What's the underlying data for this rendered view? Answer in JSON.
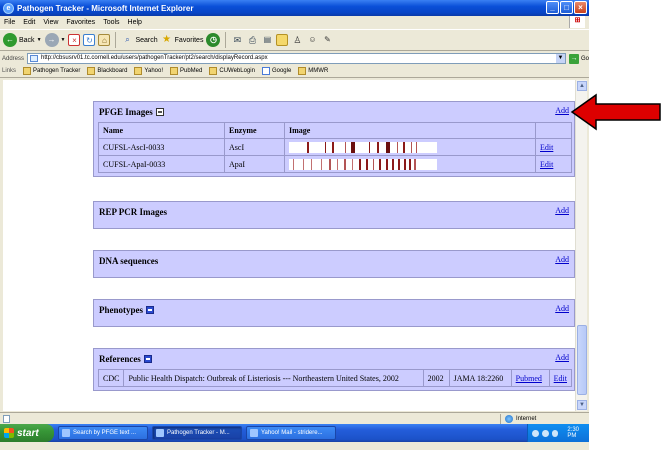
{
  "window": {
    "title": "Pathogen Tracker - Microsoft Internet Explorer",
    "min": "_",
    "max": "□",
    "close": "×"
  },
  "menu": [
    "File",
    "Edit",
    "View",
    "Favorites",
    "Tools",
    "Help"
  ],
  "toolbar": {
    "back": "Back",
    "search": "Search",
    "favorites": "Favorites"
  },
  "address": {
    "label": "Address",
    "url": "http://cbsusrv01.tc.cornell.edu/users/pathogenTracker/pt2/search/displayRecord.aspx",
    "go": "Go"
  },
  "links": {
    "label": "Links",
    "items": [
      "Pathogen Tracker",
      "Blackboard",
      "Yahoo!",
      "PubMed",
      "CUWebLogin",
      "Google",
      "MMWR"
    ]
  },
  "sections": {
    "pfge": {
      "title": "PFGE Images",
      "add": "Add",
      "columns": [
        "Name",
        "Enzyme",
        "Image",
        ""
      ],
      "rows": [
        {
          "name": "CUFSL-AscI-0033",
          "enzyme": "AscI",
          "action": "Edit"
        },
        {
          "name": "CUFSL-ApaI-0033",
          "enzyme": "ApaI",
          "action": "Edit"
        }
      ]
    },
    "rep": {
      "title": "REP PCR Images",
      "add": "Add"
    },
    "dna": {
      "title": "DNA sequences",
      "add": "Add"
    },
    "phenotypes": {
      "title": "Phenotypes",
      "add": "Add"
    },
    "references": {
      "title": "References",
      "add": "Add",
      "row": {
        "source": "CDC",
        "title": "Public Health Dispatch: Outbreak of Listeriosis --- Northeastern United States, 2002",
        "year": "2002",
        "journal": "JAMA 18:2260",
        "pubmed": "Pubmed",
        "edit": "Edit"
      }
    }
  },
  "status": {
    "zone": "Internet"
  },
  "taskbar": {
    "start": "start",
    "tasks": [
      "Search by PFGE text ...",
      "Pathogen Tracker - M...",
      "Yahoo! Mail - stridere..."
    ],
    "clock": "2:30 PM"
  },
  "colors": {
    "section_bg": "#ccccff",
    "link": "#0000cc",
    "arrow": "#dd0000",
    "gel_band": "#8b1a1a"
  }
}
